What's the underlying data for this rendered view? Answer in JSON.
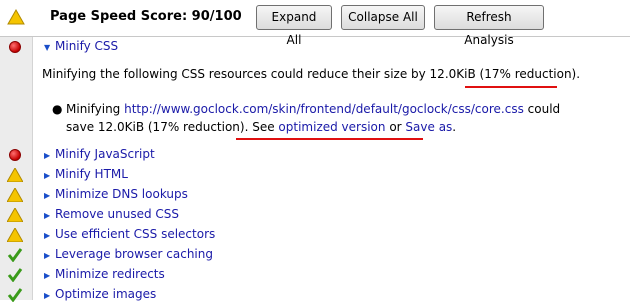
{
  "header": {
    "score_label": "Page Speed Score: 90/100",
    "expand_all": "Expand All",
    "collapse_all": "Collapse All",
    "refresh": "Refresh Analysis",
    "icon": "warning-icon"
  },
  "expanded_rule": {
    "label": "Minify CSS",
    "icon": "stop-icon",
    "summary_prefix": "Minifying the following CSS resources could reduce their size by 12.0KiB ",
    "summary_highlight": "(17% reduction)",
    "summary_suffix": ".",
    "detail": {
      "prefix": "Minifying ",
      "url": "http://www.goclock.com/skin/frontend/default/goclock/css/core.css",
      "middle": " could save 12.0KiB (17% reduction). See ",
      "optimized_link": "optimized version",
      "or": " or ",
      "save_link": "Save as",
      "suffix": "."
    }
  },
  "rules": [
    {
      "label": "Minify JavaScript",
      "icon": "stop-icon"
    },
    {
      "label": "Minify HTML",
      "icon": "warning-icon"
    },
    {
      "label": "Minimize DNS lookups",
      "icon": "warning-icon"
    },
    {
      "label": "Remove unused CSS",
      "icon": "warning-icon"
    },
    {
      "label": "Use efficient CSS selectors",
      "icon": "warning-icon"
    },
    {
      "label": "Leverage browser caching",
      "icon": "check-icon"
    },
    {
      "label": "Minimize redirects",
      "icon": "check-icon"
    },
    {
      "label": "Optimize images",
      "icon": "check-icon"
    }
  ],
  "colors": {
    "link": "#1a1aa8",
    "annotation": "#e01010",
    "stop": "#c40000",
    "warning": "#f5c400",
    "check": "#3a9a1a"
  }
}
